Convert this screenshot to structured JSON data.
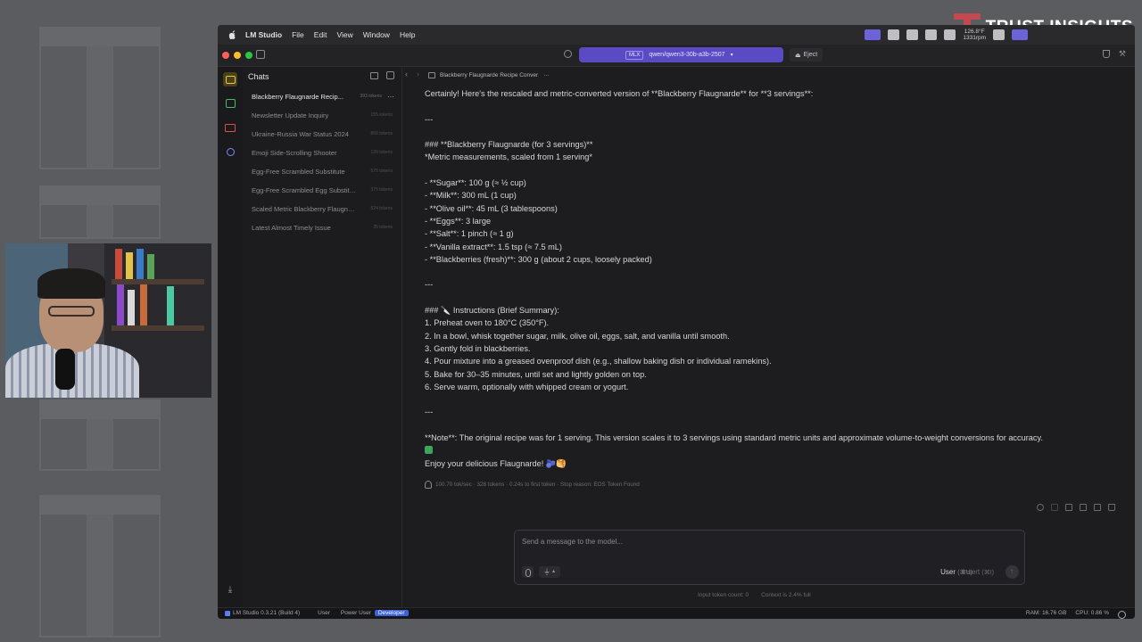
{
  "app": {
    "name": "LM Studio",
    "menus": [
      "File",
      "Edit",
      "View",
      "Window",
      "Help"
    ]
  },
  "brand": {
    "text": "TRUST INSIGHTS"
  },
  "system_status": {
    "temp": "126.8°F",
    "rpm": "1331rpm"
  },
  "toolbar": {
    "model": "qwen/qwen3-30b-a3b-2507",
    "model_badge": "MLX",
    "eject_label": "Eject"
  },
  "sidebar": {
    "title": "Chats",
    "items": [
      {
        "label": "Blackberry Flaugnarde Recip...",
        "tokens": "393 tokens",
        "active": true
      },
      {
        "label": "Newsletter Update Inquiry",
        "tokens": "155 tokens"
      },
      {
        "label": "Ukraine-Russia War Status 2024",
        "tokens": "866 tokens"
      },
      {
        "label": "Emoji Side-Scrolling Shooter",
        "tokens": "135 tokens"
      },
      {
        "label": "Egg-Free Scrambled Substitute",
        "tokens": "570 tokens"
      },
      {
        "label": "Egg-Free Scrambled Egg Substitu...",
        "tokens": "375 tokens"
      },
      {
        "label": "Scaled Metric Blackberry Flaugna...",
        "tokens": "524 tokens"
      },
      {
        "label": "Latest Almost Timely Issue",
        "tokens": "35 tokens"
      }
    ]
  },
  "tab": {
    "title": "Blackberry Flaugnarde Recipe Conver"
  },
  "message": {
    "lines": [
      "Certainly! Here's the rescaled and metric-converted version of **Blackberry Flaugnarde** for **3 servings**:",
      "",
      "---",
      "",
      "### **Blackberry Flaugnarde (for 3 servings)**",
      "*Metric measurements, scaled from 1 serving*",
      "",
      "- **Sugar**: 100 g (≈ ½ cup)",
      "- **Milk**: 300 mL (1 cup)",
      "- **Olive oil**: 45 mL (3 tablespoons)",
      "- **Eggs**: 3 large",
      "- **Salt**: 1 pinch (≈ 1 g)",
      "- **Vanilla extract**: 1.5 tsp (≈ 7.5 mL)",
      "- **Blackberries (fresh)**: 300 g (about 2 cups, loosely packed)",
      "",
      "---",
      "",
      "### 🔪 Instructions (Brief Summary):",
      "1. Preheat oven to 180°C (350°F).",
      "2. In a bowl, whisk together sugar, milk, olive oil, eggs, salt, and vanilla until smooth.",
      "3. Gently fold in blackberries.",
      "4. Pour mixture into a greased ovenproof dish (e.g., shallow baking dish or individual ramekins).",
      "5. Bake for 30–35 minutes, until set and lightly golden on top.",
      "6. Serve warm, optionally with whipped cream or yogurt.",
      "",
      "---",
      "",
      "**Note**: The original recipe was for 1 serving. This version scales it to 3 servings using standard metric units and approximate volume-to-weight conversions for accuracy.",
      "",
      "Enjoy your delicious Flaugnarde! 🫐🥞"
    ],
    "note_line_index": 28,
    "meta": "100.70 tok/sec · 328 tokens · 0.24s to first token · Stop reason: EOS Token Found"
  },
  "composer": {
    "placeholder": "Send a message to the model...",
    "role_label": "User",
    "role_shortcut": "(⌘U)",
    "insert_label": "Insert",
    "insert_shortcut": "(⌘I)",
    "input_tokens": "Input token count:  0",
    "context": "Context is 2.4% full"
  },
  "statusbar": {
    "version": "LM Studio 0.3.21 (Build 4)",
    "modes": [
      "User",
      "Power User",
      "Developer"
    ],
    "active_mode": "Developer",
    "ram": "RAM: 16.76 GB",
    "cpu": "CPU: 0.86 %"
  },
  "colors": {
    "accent": "#5a4bc4",
    "developer": "#3a63d8",
    "background": "#1d1d20"
  }
}
